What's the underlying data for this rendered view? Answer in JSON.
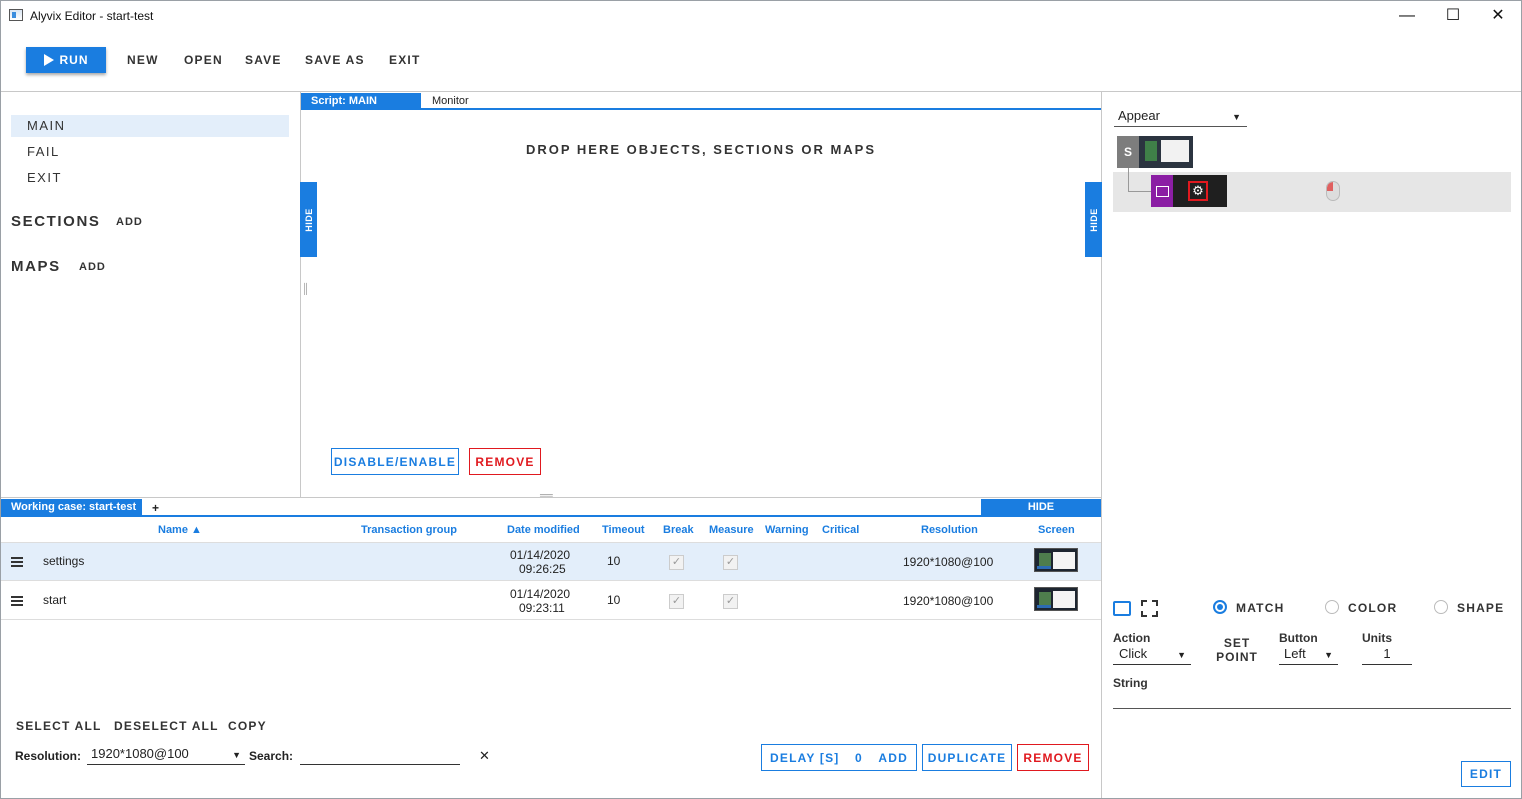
{
  "window": {
    "title": "Alyvix Editor - start-test",
    "minimize": "—",
    "maximize": "☐",
    "close": "✕"
  },
  "toolbar": {
    "run": "RUN",
    "new": "NEW",
    "open": "OPEN",
    "save": "SAVE",
    "save_as": "SAVE AS",
    "exit": "EXIT"
  },
  "nav": {
    "scripts": [
      "MAIN",
      "FAIL",
      "EXIT"
    ],
    "sections_title": "SECTIONS",
    "sections_add": "ADD",
    "maps_title": "MAPS",
    "maps_add": "ADD"
  },
  "editor": {
    "script_tab": "Script: MAIN",
    "monitor_tab": "Monitor",
    "drop_text": "DROP HERE OBJECTS, SECTIONS OR MAPS",
    "hide": "HIDE",
    "disable_enable": "DISABLE/ENABLE",
    "remove": "REMOVE"
  },
  "cases": {
    "tab": "Working case: start-test",
    "plus": "+",
    "hide": "HIDE",
    "columns": {
      "name": "Name ▲",
      "transaction_group": "Transaction group",
      "date_modified": "Date modified",
      "timeout": "Timeout",
      "break": "Break",
      "measure": "Measure",
      "warning": "Warning",
      "critical": "Critical",
      "resolution": "Resolution",
      "screen": "Screen"
    },
    "rows": [
      {
        "name": "settings",
        "date": "01/14/2020",
        "time": "09:26:25",
        "timeout": "10",
        "break": "✓",
        "measure": "✓",
        "resolution": "1920*1080@100",
        "selected": true
      },
      {
        "name": "start",
        "date": "01/14/2020",
        "time": "09:23:11",
        "timeout": "10",
        "break": "✓",
        "measure": "✓",
        "resolution": "1920*1080@100",
        "selected": false
      }
    ],
    "select_all": "SELECT ALL",
    "deselect_all": "DESELECT ALL",
    "copy": "COPY",
    "resolution_label": "Resolution:",
    "resolution_value": "1920*1080@100",
    "search_label": "Search:",
    "search_value": "",
    "clear": "✕",
    "delay_label": "DELAY [S]",
    "delay_value": "0",
    "add": "ADD",
    "duplicate": "DUPLICATE",
    "remove": "REMOVE"
  },
  "inspector": {
    "condition": "Appear",
    "tree_root": "S",
    "modes": {
      "match": "MATCH",
      "color": "COLOR",
      "shape": "SHAPE",
      "selected": "match"
    },
    "action_label": "Action",
    "action_value": "Click",
    "set_point": "SET POINT",
    "button_label": "Button",
    "button_value": "Left",
    "units_label": "Units",
    "units_value": "1",
    "string_label": "String",
    "string_value": "",
    "edit": "EDIT"
  },
  "colors": {
    "accent": "#1a7de0",
    "danger": "#e0191f",
    "selection": "#e3eefa"
  }
}
